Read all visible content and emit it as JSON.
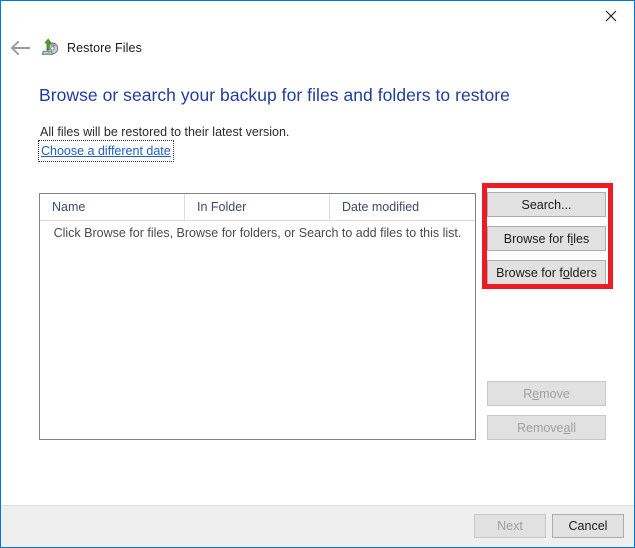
{
  "window": {
    "app_title": "Restore Files",
    "app_icon": "restore-files-icon",
    "back_icon": "back-arrow-icon",
    "close_icon": "close-icon",
    "border_color": "#0078d7"
  },
  "page": {
    "heading": "Browse or search your backup for files and folders to restore",
    "heading_color": "#1f3da1",
    "subtext": "All files will be restored to their latest version.",
    "date_link": "Choose a different date",
    "date_link_color": "#1f5fbf"
  },
  "listview": {
    "columns": [
      {
        "label": "Name"
      },
      {
        "label": "In Folder"
      },
      {
        "label": "Date modified"
      }
    ],
    "empty_message": "Click Browse for files, Browse for folders, or Search to add files to this list.",
    "rows": []
  },
  "actions": {
    "search": {
      "pre": "S",
      "mnemonic": "",
      "post": "earch...",
      "label": "Search...",
      "enabled": true
    },
    "browse_files": {
      "pre": "Browse for f",
      "mnemonic": "i",
      "post": "les",
      "label": "Browse for files",
      "enabled": true
    },
    "browse_folders": {
      "pre": "Browse for f",
      "mnemonic": "o",
      "post": "lders",
      "label": "Browse for folders",
      "enabled": true
    },
    "remove": {
      "pre": "R",
      "mnemonic": "e",
      "post": "move",
      "label": "Remove",
      "enabled": false
    },
    "remove_all": {
      "pre": "Remove ",
      "mnemonic": "a",
      "post": "ll",
      "label": "Remove all",
      "enabled": false
    }
  },
  "footer": {
    "next": {
      "pre": "N",
      "mnemonic": "",
      "post": "ext",
      "label": "Next",
      "enabled": false
    },
    "cancel": {
      "pre": "",
      "mnemonic": "",
      "post": "Cancel",
      "label": "Cancel",
      "enabled": true
    }
  },
  "annotation": {
    "color": "#ed1c24",
    "targets": "Search... / Browse for files / Browse for folders"
  }
}
